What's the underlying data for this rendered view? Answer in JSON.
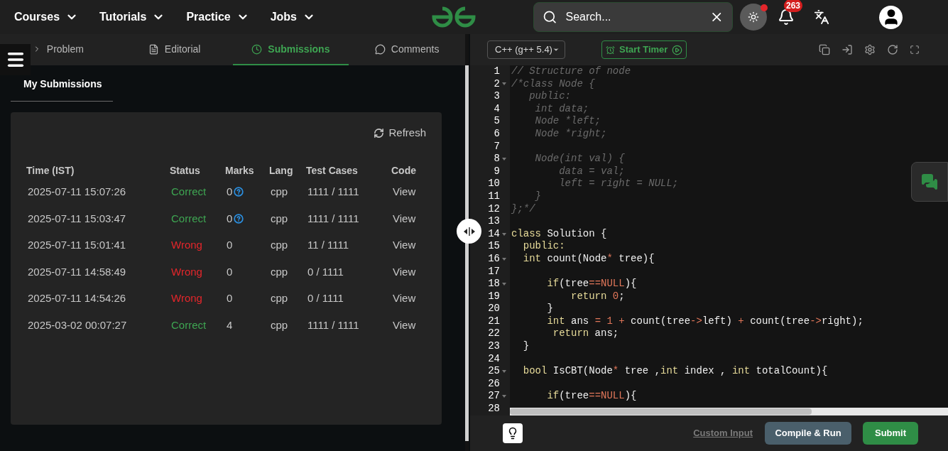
{
  "nav": {
    "menus": [
      "Courses",
      "Tutorials",
      "Practice",
      "Jobs"
    ],
    "search": {
      "placeholder": "Search..."
    },
    "notifications": {
      "count": "263"
    },
    "theme_dot": true
  },
  "tabs": [
    {
      "label": "Problem",
      "selected": false
    },
    {
      "label": "Editorial",
      "selected": false
    },
    {
      "label": "Submissions",
      "selected": true
    },
    {
      "label": "Comments",
      "selected": false
    }
  ],
  "section_title": "My Submissions",
  "refresh": "Refresh",
  "table": {
    "columns": [
      "Time (IST)",
      "Status",
      "Marks",
      "Lang",
      "Test Cases",
      "Code"
    ],
    "rows": [
      {
        "time": "2025-07-11 15:07:26",
        "status": "Correct",
        "passed": true,
        "marks": "0",
        "hint_icon": true,
        "lang": "cpp",
        "tests": "1111 / 1111",
        "code": "View"
      },
      {
        "time": "2025-07-11 15:03:47",
        "status": "Correct",
        "passed": true,
        "marks": "0",
        "hint_icon": true,
        "lang": "cpp",
        "tests": "1111 / 1111",
        "code": "View"
      },
      {
        "time": "2025-07-11 15:01:41",
        "status": "Wrong",
        "passed": false,
        "marks": "0",
        "hint_icon": false,
        "lang": "cpp",
        "tests": "11 / 1111",
        "code": "View"
      },
      {
        "time": "2025-07-11 14:58:49",
        "status": "Wrong",
        "passed": false,
        "marks": "0",
        "hint_icon": false,
        "lang": "cpp",
        "tests": "0 / 1111",
        "code": "View"
      },
      {
        "time": "2025-07-11 14:54:26",
        "status": "Wrong",
        "passed": false,
        "marks": "0",
        "hint_icon": false,
        "lang": "cpp",
        "tests": "0 / 1111",
        "code": "View"
      },
      {
        "time": "2025-03-02 00:07:27",
        "status": "Correct",
        "passed": true,
        "marks": "4",
        "hint_icon": false,
        "lang": "cpp",
        "tests": "1111 / 1111",
        "code": "View"
      }
    ]
  },
  "editor": {
    "language": "C++ (g++ 5.4)",
    "timer": "Start Timer",
    "lines": [
      {
        "number": "1",
        "fold": false,
        "tokens": [
          {
            "kind": "comment",
            "text": "// Structure of node"
          }
        ]
      },
      {
        "number": "2",
        "fold": true,
        "tokens": [
          {
            "kind": "comment",
            "text": "/*class Node {"
          }
        ]
      },
      {
        "number": "3",
        "fold": false,
        "tokens": [
          {
            "kind": "comment",
            "text": "   public:"
          }
        ]
      },
      {
        "number": "4",
        "fold": false,
        "tokens": [
          {
            "kind": "comment",
            "text": "    int data;"
          }
        ]
      },
      {
        "number": "5",
        "fold": false,
        "tokens": [
          {
            "kind": "comment",
            "text": "    Node *left;"
          }
        ]
      },
      {
        "number": "6",
        "fold": false,
        "tokens": [
          {
            "kind": "comment",
            "text": "    Node *right;"
          }
        ]
      },
      {
        "number": "7",
        "fold": false
      },
      {
        "number": "8",
        "fold": true,
        "tokens": [
          {
            "kind": "comment",
            "text": "    Node(int val) {"
          }
        ]
      },
      {
        "number": "9",
        "fold": false,
        "tokens": [
          {
            "kind": "comment",
            "text": "        data = val;"
          }
        ]
      },
      {
        "number": "10",
        "fold": false,
        "tokens": [
          {
            "kind": "comment",
            "text": "        left = right = NULL;"
          }
        ]
      },
      {
        "number": "11",
        "fold": false,
        "tokens": [
          {
            "kind": "comment",
            "text": "    }"
          }
        ]
      },
      {
        "number": "12",
        "fold": false,
        "tokens": [
          {
            "kind": "comment",
            "text": "};*/"
          }
        ]
      },
      {
        "number": "13",
        "fold": false
      },
      {
        "number": "14",
        "fold": true,
        "tokens": [
          {
            "kind": "keyword",
            "text": "class"
          },
          {
            "kind": "plain",
            "text": " Solution {"
          }
        ]
      },
      {
        "number": "15",
        "fold": false,
        "tokens": [
          {
            "kind": "keyword",
            "text": "  public:"
          }
        ]
      },
      {
        "number": "16",
        "fold": true,
        "tokens": [
          {
            "kind": "keyword",
            "text": "  int"
          },
          {
            "kind": "plain",
            "text": " count(Node"
          },
          {
            "kind": "operator",
            "text": "*"
          },
          {
            "kind": "plain",
            "text": " tree){"
          }
        ]
      },
      {
        "number": "17",
        "fold": false
      },
      {
        "number": "18",
        "fold": true,
        "tokens": [
          {
            "kind": "keyword",
            "text": "      if"
          },
          {
            "kind": "plain",
            "text": "(tree"
          },
          {
            "kind": "operator",
            "text": "=="
          },
          {
            "kind": "number",
            "text": "NULL"
          },
          {
            "kind": "plain",
            "text": "){"
          }
        ]
      },
      {
        "number": "19",
        "fold": false,
        "tokens": [
          {
            "kind": "keyword",
            "text": "          return"
          },
          {
            "kind": "number",
            "text": " 0"
          },
          {
            "kind": "plain",
            "text": ";"
          }
        ]
      },
      {
        "number": "20",
        "fold": false,
        "tokens": [
          {
            "kind": "plain",
            "text": "      }"
          }
        ]
      },
      {
        "number": "21",
        "fold": false,
        "tokens": [
          {
            "kind": "keyword",
            "text": "      int"
          },
          {
            "kind": "plain",
            "text": " ans "
          },
          {
            "kind": "operator",
            "text": "="
          },
          {
            "kind": "number",
            "text": " 1"
          },
          {
            "kind": "operator",
            "text": " +"
          },
          {
            "kind": "plain",
            "text": " count(tree"
          },
          {
            "kind": "operator",
            "text": "->"
          },
          {
            "kind": "plain",
            "text": "left) "
          },
          {
            "kind": "operator",
            "text": "+"
          },
          {
            "kind": "plain",
            "text": " count(tree"
          },
          {
            "kind": "operator",
            "text": "->"
          },
          {
            "kind": "plain",
            "text": "right);"
          }
        ]
      },
      {
        "number": "22",
        "fold": false,
        "tokens": [
          {
            "kind": "keyword",
            "text": "       return"
          },
          {
            "kind": "plain",
            "text": " ans;"
          }
        ]
      },
      {
        "number": "23",
        "fold": false,
        "tokens": [
          {
            "kind": "plain",
            "text": "  }"
          }
        ]
      },
      {
        "number": "24",
        "fold": false
      },
      {
        "number": "25",
        "fold": true,
        "tokens": [
          {
            "kind": "keyword",
            "text": "  bool"
          },
          {
            "kind": "plain",
            "text": " IsCBT(Node"
          },
          {
            "kind": "operator",
            "text": "*"
          },
          {
            "kind": "plain",
            "text": " tree ,"
          },
          {
            "kind": "keyword",
            "text": "int"
          },
          {
            "kind": "plain",
            "text": " index , "
          },
          {
            "kind": "keyword",
            "text": "int"
          },
          {
            "kind": "plain",
            "text": " totalCount){"
          }
        ]
      },
      {
        "number": "26",
        "fold": false
      },
      {
        "number": "27",
        "fold": true,
        "tokens": [
          {
            "kind": "keyword",
            "text": "      if"
          },
          {
            "kind": "plain",
            "text": "(tree"
          },
          {
            "kind": "operator",
            "text": "=="
          },
          {
            "kind": "number",
            "text": "NULL"
          },
          {
            "kind": "plain",
            "text": "){"
          }
        ]
      },
      {
        "number": "28",
        "fold": false
      }
    ]
  },
  "footer": {
    "custom_input": "Custom Input",
    "compile": "Compile & Run",
    "submit": "Submit"
  }
}
